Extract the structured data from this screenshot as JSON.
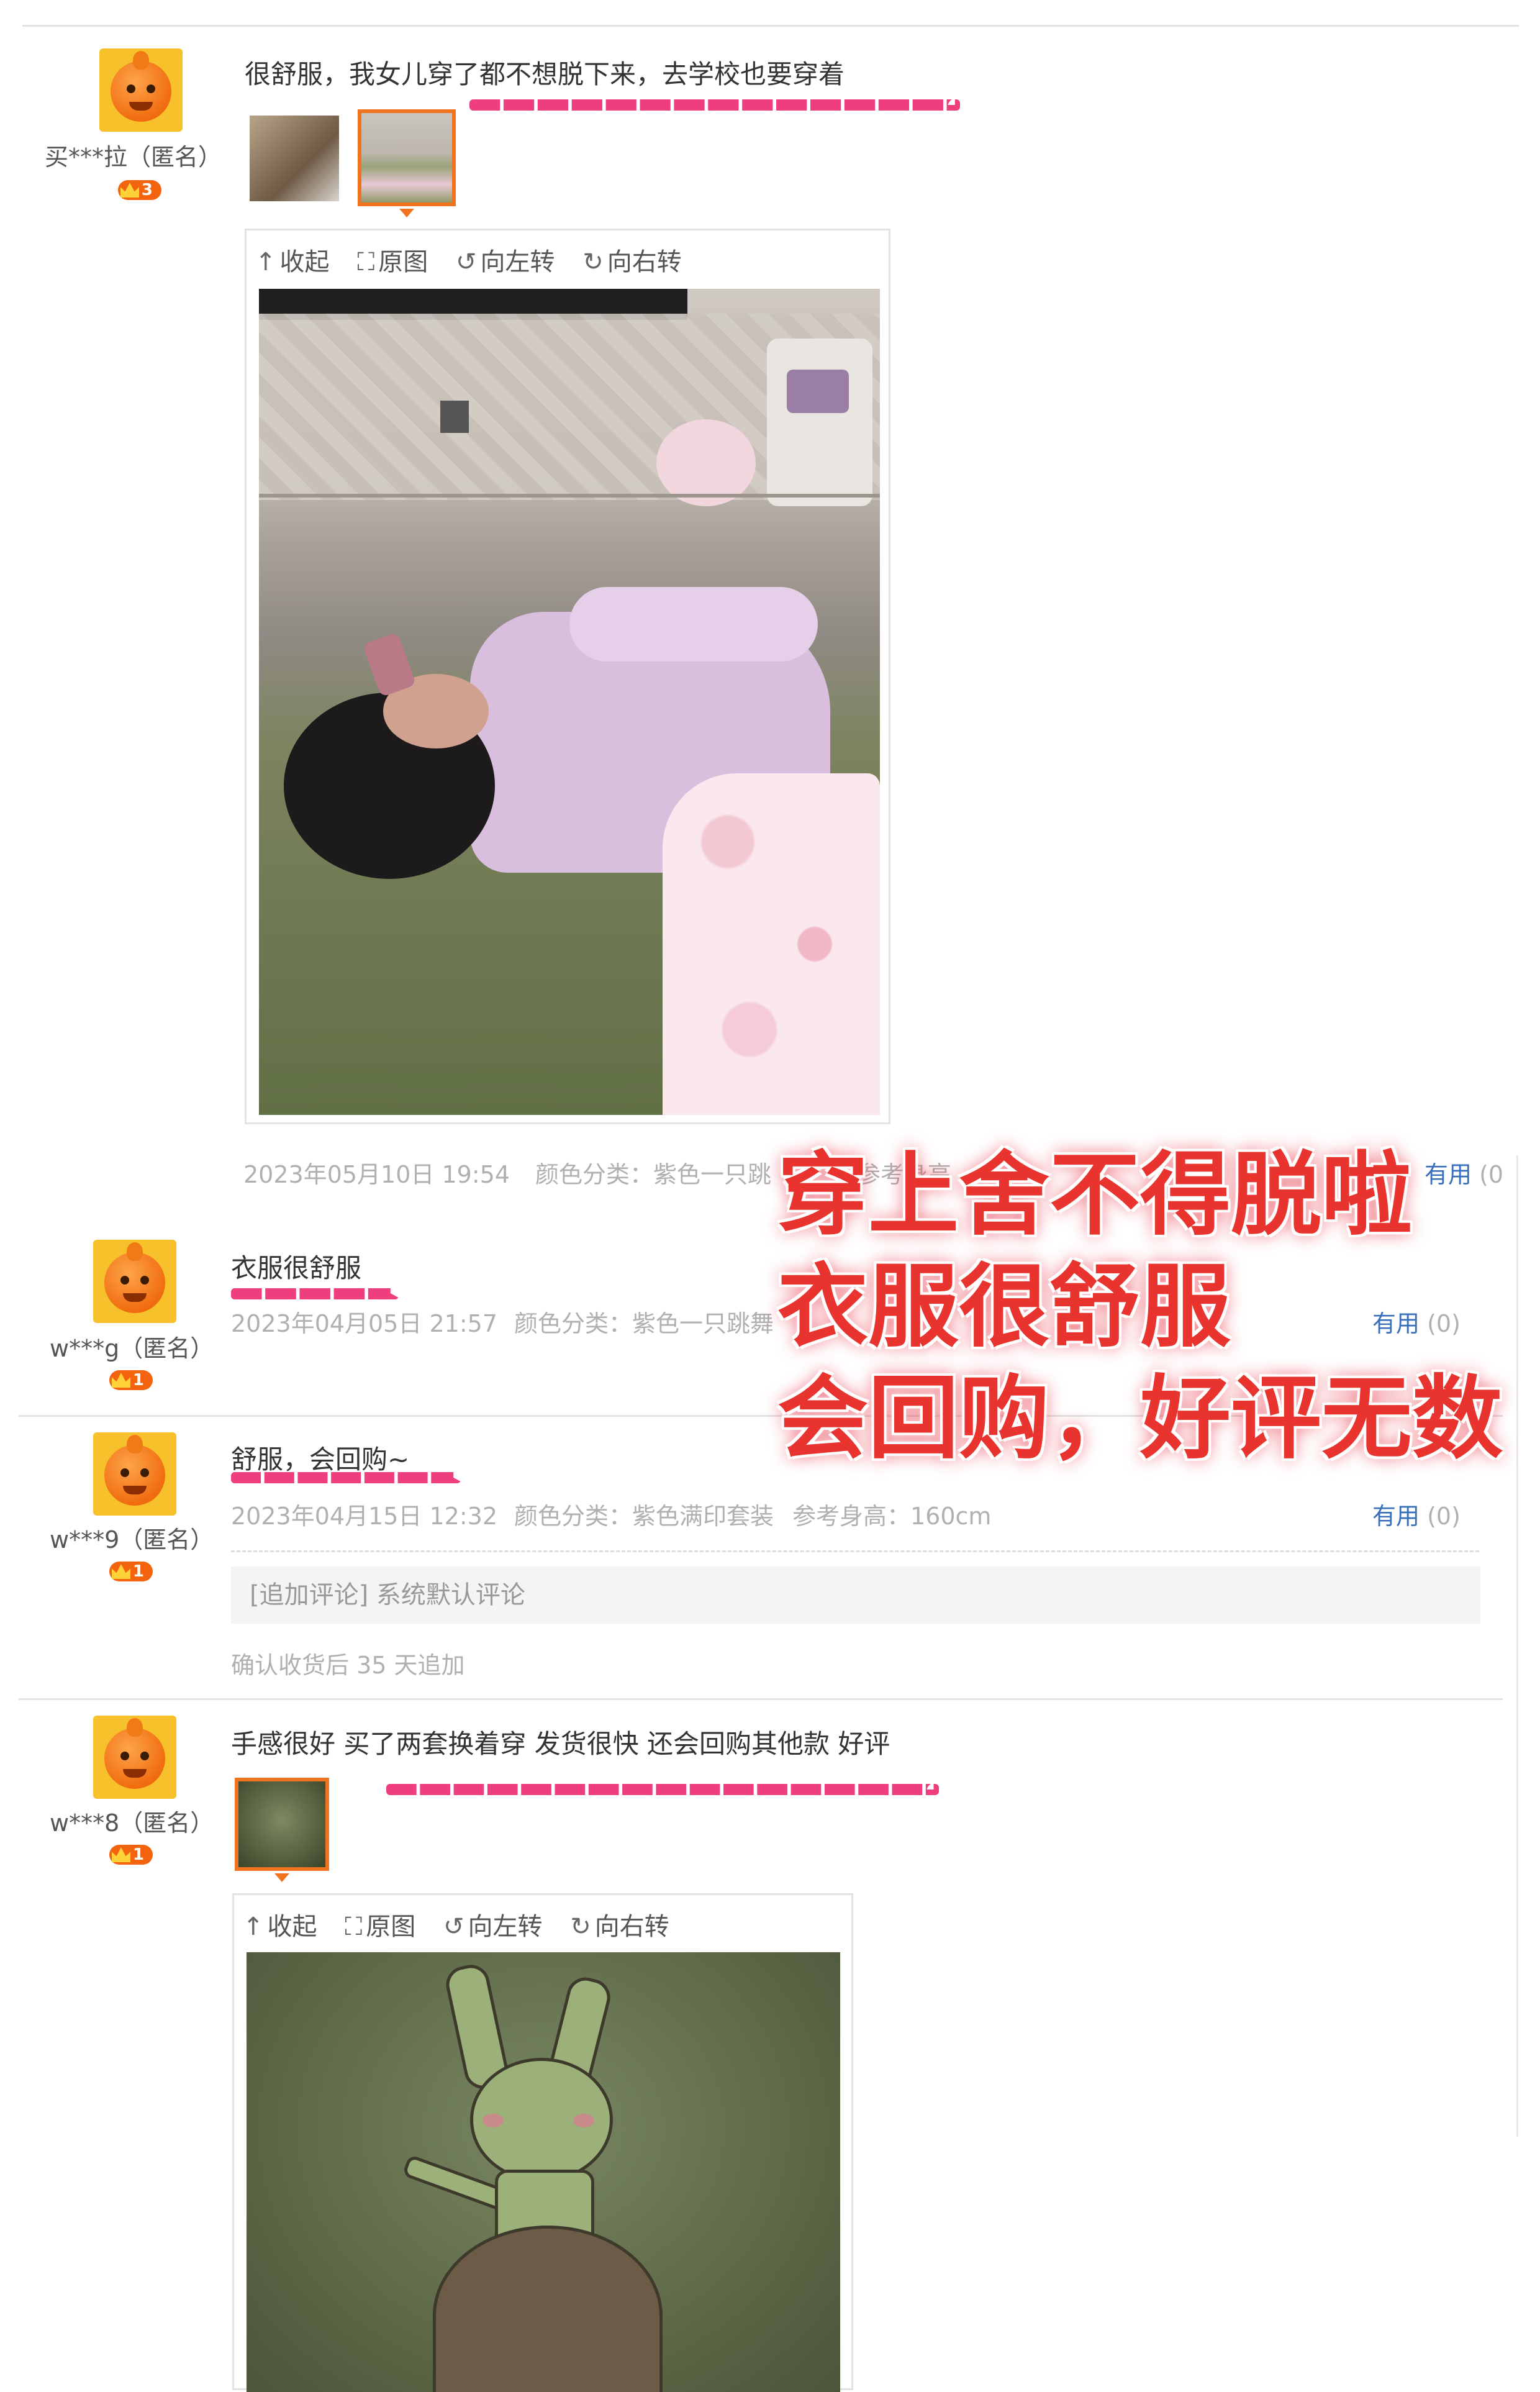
{
  "reviews": [
    {
      "user": "买***拉（匿名）",
      "level": "3",
      "comment": "很舒服，我女儿穿了都不想脱下来，去学校也要穿着",
      "date": "2023年05月10日 19:54",
      "sku": "颜色分类：紫色一只跳",
      "height_partial": "参考身高",
      "useful_label": "有用",
      "useful_count": "(0"
    },
    {
      "user": "w***g（匿名）",
      "level": "1",
      "comment": "衣服很舒服",
      "date": "2023年04月05日 21:57",
      "sku": "颜色分类：紫色一只跳舞",
      "useful_label": "有用",
      "useful_count": "(0)"
    },
    {
      "user": "w***9（匿名）",
      "level": "1",
      "comment": "舒服，会回购~",
      "date": "2023年04月15日 12:32",
      "sku": "颜色分类：紫色满印套装",
      "height": "参考身高：160cm",
      "useful_label": "有用",
      "useful_count": "(0)",
      "append_text": "[追加评论] 系统默认评论",
      "append_time": "确认收货后 35 天追加"
    },
    {
      "user": "w***8（匿名）",
      "level": "1",
      "comment": "手感很好 买了两套换着穿 发货很快 还会回购其他款 好评"
    }
  ],
  "viewer_toolbar": {
    "collapse": "收起",
    "original": "原图",
    "rotate_left": "向左转",
    "rotate_right": "向右转",
    "collapse_icon": "arrow-up-icon",
    "original_icon": "expand-icon",
    "rotate_left_icon": "rotate-left-icon",
    "rotate_right_icon": "rotate-right-icon"
  },
  "overlay": {
    "line1": "穿上舍不得脱啦",
    "line2": "衣服很舒服",
    "line3": "会回购，好评无数"
  },
  "colors": {
    "accent": "#f07420",
    "link": "#3a6fb9",
    "highlight": "#ef3e7d",
    "overlay_text": "#e8332e"
  }
}
